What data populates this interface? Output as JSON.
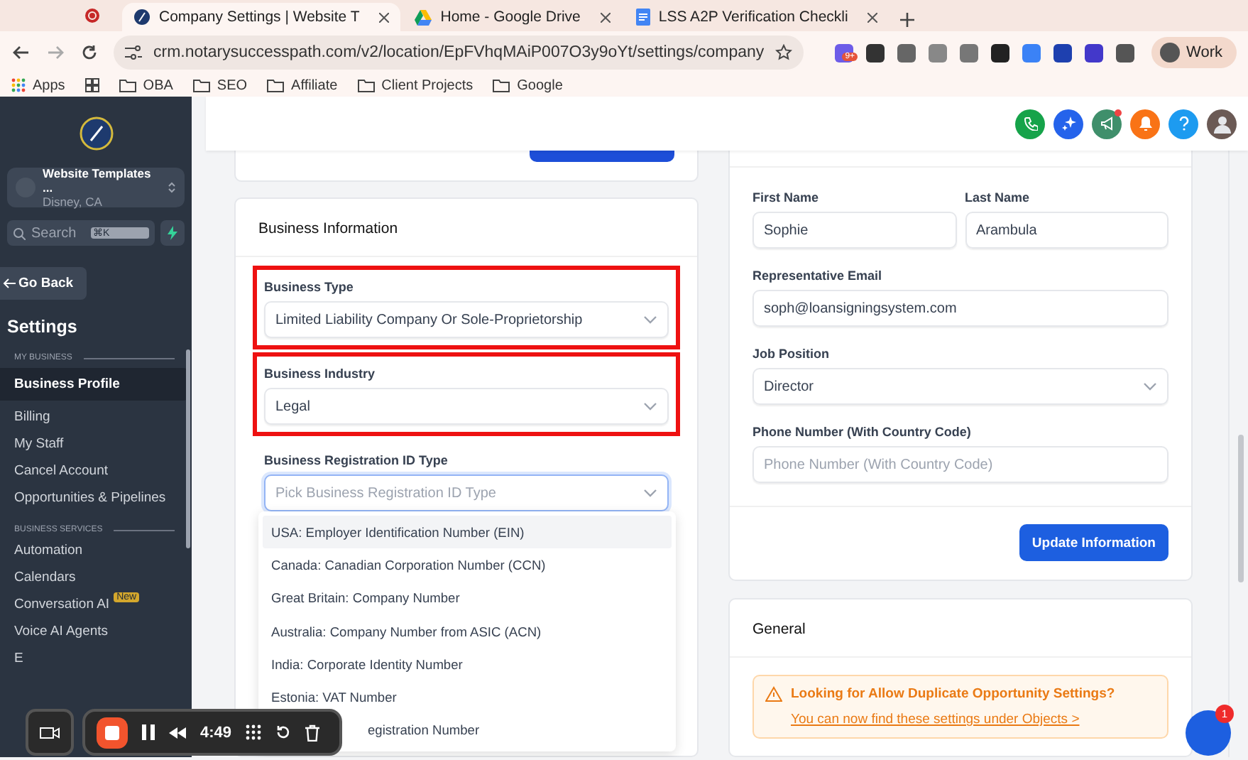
{
  "browser": {
    "tabs": [
      {
        "kind": "site",
        "title": "Company Settings | Website T",
        "selected": true
      },
      {
        "kind": "drive",
        "title": "Home - Google Drive",
        "selected": false
      },
      {
        "kind": "docs",
        "title": "LSS A2P Verification Checkli",
        "selected": false
      }
    ],
    "url": "crm.notarysuccesspath.com/v2/location/EpFVhqMAiP007O3y9oYt/settings/company",
    "extension_badge": "9+",
    "profile": "Work",
    "bookmarks": [
      {
        "kind": "apps",
        "label": "Apps"
      },
      {
        "kind": "grid"
      },
      {
        "kind": "folder",
        "label": "OBA"
      },
      {
        "kind": "folder",
        "label": "SEO"
      },
      {
        "kind": "folder",
        "label": "Affiliate"
      },
      {
        "kind": "folder",
        "label": "Client Projects"
      },
      {
        "kind": "folder",
        "label": "Google"
      }
    ]
  },
  "sidebar": {
    "location": {
      "name": "Website Templates ...",
      "city": "Disney, CA"
    },
    "search": {
      "placeholder": "Search",
      "shortcut": "⌘K"
    },
    "back": "Go Back",
    "title": "Settings",
    "sections": [
      {
        "heading": "MY BUSINESS",
        "items": [
          {
            "label": "Business Profile",
            "selected": true
          },
          {
            "label": "Billing",
            "selected": false
          },
          {
            "label": "My Staff",
            "selected": false
          },
          {
            "label": "Cancel Account",
            "selected": false
          },
          {
            "label": "Opportunities & Pipelines",
            "selected": false
          }
        ]
      },
      {
        "heading": "BUSINESS SERVICES",
        "items": [
          {
            "label": "Automation",
            "selected": false
          },
          {
            "label": "Calendars",
            "selected": false
          },
          {
            "label": "Conversation AI",
            "badge": "New",
            "selected": false
          },
          {
            "label": "Voice AI Agents",
            "selected": false
          },
          {
            "label": "E",
            "selected": false
          }
        ]
      }
    ]
  },
  "header": {
    "notification_dot": true
  },
  "business_info": {
    "title": "Business Information",
    "fields": [
      {
        "label": "Business Type",
        "value": "Limited Liability Company Or Sole-Proprietorship",
        "highlighted": true,
        "focused": false
      },
      {
        "label": "Business Industry",
        "value": "Legal",
        "highlighted": true,
        "focused": false
      },
      {
        "label": "Business Registration ID Type",
        "placeholder": "Pick Business Registration ID Type",
        "highlighted": false,
        "focused": true
      }
    ],
    "dropdown_options": [
      {
        "label": "USA: Employer Identification Number (EIN)",
        "selected": true,
        "kind": "full"
      },
      {
        "label": "Canada: Canadian Corporation Number (CCN)",
        "selected": false,
        "kind": "full"
      },
      {
        "label": "Great Britain: Company Number",
        "selected": false,
        "kind": "full"
      },
      {
        "label": "Australia: Company Number from ASIC (ACN)",
        "selected": false,
        "kind": "full"
      },
      {
        "label": "India: Corporate Identity Number",
        "selected": false,
        "kind": "full"
      },
      {
        "label": "Estonia: VAT Number",
        "selected": false,
        "kind": "full"
      },
      {
        "label": "egistration Number",
        "selected": false,
        "kind": "covered"
      }
    ]
  },
  "representative": {
    "name_fields": [
      {
        "label": "First Name",
        "value": "Sophie"
      },
      {
        "label": "Last Name",
        "value": "Arambula"
      }
    ],
    "fields": [
      {
        "kind": "input",
        "label": "Representative Email",
        "value": "soph@loansigningsystem.com"
      },
      {
        "kind": "select",
        "label": "Job Position",
        "value": "Director"
      },
      {
        "kind": "input",
        "label": "Phone Number (With Country Code)",
        "placeholder": "Phone Number (With Country Code)"
      }
    ],
    "button": "Update Information"
  },
  "general": {
    "title": "General",
    "alert_title": "Looking for Allow Duplicate Opportunity Settings?",
    "alert_text": "You can now find these settings under Objects >"
  },
  "chat": {
    "badge": "1"
  },
  "recorder": {
    "time": "4:49"
  }
}
